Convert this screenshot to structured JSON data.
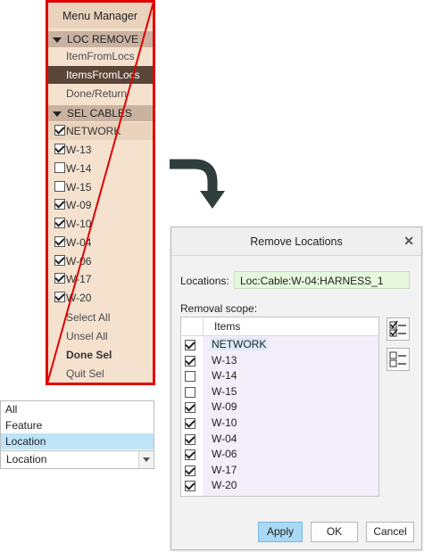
{
  "menu_manager": {
    "title": "Menu Manager",
    "loc_remove": {
      "header": "LOC REMOVE",
      "items": [
        "ItemFromLocs",
        "ItemsFromLocs",
        "Done/Return"
      ],
      "selected": "ItemsFromLocs"
    },
    "sel_cables": {
      "header": "SEL CABLES",
      "cables": [
        {
          "label": "NETWORK",
          "checked": true
        },
        {
          "label": "W-13",
          "checked": true
        },
        {
          "label": "W-14",
          "checked": false
        },
        {
          "label": "W-15",
          "checked": false
        },
        {
          "label": "W-09",
          "checked": true
        },
        {
          "label": "W-10",
          "checked": true
        },
        {
          "label": "W-04",
          "checked": true
        },
        {
          "label": "W-06",
          "checked": true
        },
        {
          "label": "W-17",
          "checked": true
        },
        {
          "label": "W-20",
          "checked": true
        }
      ],
      "actions": [
        "Select All",
        "Unsel All",
        "Done Sel",
        "Quit Sel"
      ]
    }
  },
  "filter": {
    "options": [
      "All",
      "Feature",
      "Location"
    ],
    "highlighted": "Location",
    "selected_value": "Location"
  },
  "dialog": {
    "title": "Remove Locations",
    "locations_label": "Locations:",
    "locations_value": "Loc:Cable:W-04:HARNESS_1",
    "scope_label": "Removal scope:",
    "column_header": "Items",
    "items": [
      {
        "label": "NETWORK",
        "checked": true
      },
      {
        "label": "W-13",
        "checked": true
      },
      {
        "label": "W-14",
        "checked": false
      },
      {
        "label": "W-15",
        "checked": false
      },
      {
        "label": "W-09",
        "checked": true
      },
      {
        "label": "W-10",
        "checked": true
      },
      {
        "label": "W-04",
        "checked": true
      },
      {
        "label": "W-06",
        "checked": true
      },
      {
        "label": "W-17",
        "checked": true
      },
      {
        "label": "W-20",
        "checked": true
      }
    ],
    "buttons": {
      "apply": "Apply",
      "ok": "OK",
      "cancel": "Cancel"
    }
  },
  "colors": {
    "menu_bg": "#f4e2cf",
    "menu_selected": "#5a4638",
    "red_annotation": "#e00000",
    "apply_button": "#a9d9f5",
    "location_field": "#e5f7dc"
  },
  "icons": [
    "close-icon",
    "select-all-icon",
    "deselect-all-icon",
    "curved-arrow-icon"
  ]
}
